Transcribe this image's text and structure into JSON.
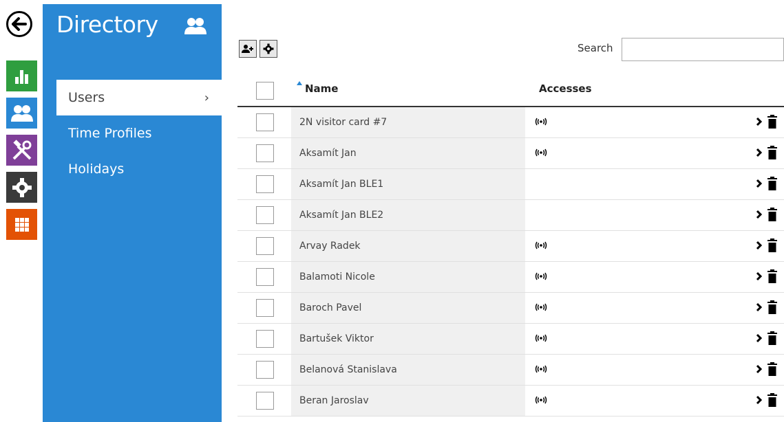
{
  "sidebar": {
    "title": "Directory",
    "items": [
      {
        "label": "Users",
        "chevron": "›",
        "active": true
      },
      {
        "label": "Time Profiles"
      },
      {
        "label": "Holidays"
      }
    ]
  },
  "rail": {
    "colors": {
      "status": "#2f9e3f",
      "directory": "#2a88d4",
      "services": "#7f3f98",
      "hardware": "#3a3a3a",
      "system": "#e35205"
    }
  },
  "toolbar": {
    "search_label": "Search",
    "search_value": "",
    "add_user_icon": "add-user-icon",
    "settings_icon": "gear-icon"
  },
  "table": {
    "columns": {
      "name": "Name",
      "accesses": "Accesses"
    },
    "rows": [
      {
        "name": "2N visitor card #7",
        "access": true
      },
      {
        "name": "Aksamít Jan",
        "access": true
      },
      {
        "name": "Aksamít Jan BLE1",
        "access": false
      },
      {
        "name": "Aksamít Jan BLE2",
        "access": false
      },
      {
        "name": "Arvay Radek",
        "access": true
      },
      {
        "name": "Balamoti Nicole",
        "access": true
      },
      {
        "name": "Baroch Pavel",
        "access": true
      },
      {
        "name": "Bartušek Viktor",
        "access": true
      },
      {
        "name": "Belanová Stanislava",
        "access": true
      },
      {
        "name": "Beran Jaroslav",
        "access": true
      }
    ]
  }
}
